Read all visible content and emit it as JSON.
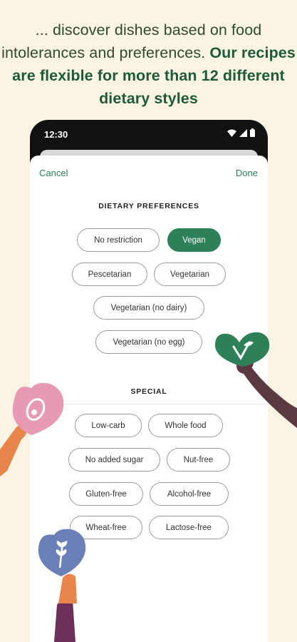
{
  "headline": {
    "regular": "... discover dishes based on food intolerances and preferences. ",
    "bold": "Our recipes are flexible for more than 12 different dietary styles"
  },
  "status_bar": {
    "time": "12:30"
  },
  "sheet": {
    "cancel": "Cancel",
    "done": "Done"
  },
  "dietary_preferences": {
    "title": "DIETARY PREFERENCES",
    "chips": [
      {
        "label": "No restriction",
        "selected": false
      },
      {
        "label": "Vegan",
        "selected": true
      },
      {
        "label": "Pescetarian",
        "selected": false
      },
      {
        "label": "Vegetarian",
        "selected": false
      },
      {
        "label": "Vegetarian (no dairy)",
        "selected": false
      },
      {
        "label": "Vegetarian (no egg)",
        "selected": false
      }
    ]
  },
  "special": {
    "title": "SPECIAL",
    "chips": [
      {
        "label": "Low-carb",
        "selected": false
      },
      {
        "label": "Whole food",
        "selected": false
      },
      {
        "label": "No added sugar",
        "selected": false
      },
      {
        "label": "Nut-free",
        "selected": false
      },
      {
        "label": "Gluten-free",
        "selected": false
      },
      {
        "label": "Alcohol-free",
        "selected": false
      },
      {
        "label": "Wheat-free",
        "selected": false
      },
      {
        "label": "Lactose-free",
        "selected": false
      }
    ]
  },
  "colors": {
    "background": "#FBF3E3",
    "accent": "#2E8058",
    "headline": "#2E4A30"
  },
  "icons": [
    "wifi-icon",
    "signal-icon",
    "battery-icon",
    "leaf-heart-icon",
    "avocado-heart-icon",
    "wheat-heart-icon"
  ]
}
